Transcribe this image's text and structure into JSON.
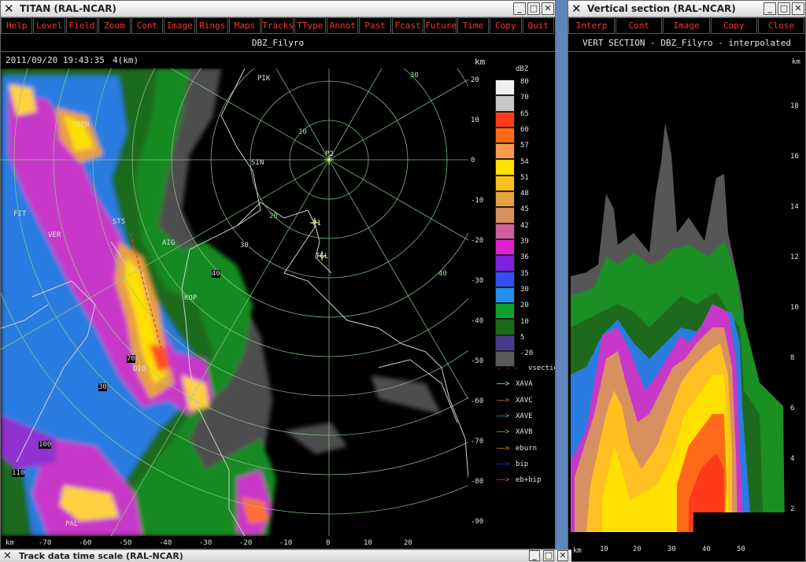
{
  "main_window": {
    "title": "TITAN (RAL-NCAR)",
    "menu": [
      "Help",
      "Level",
      "Field",
      "Zoom",
      "Cont",
      "Image",
      "Rings",
      "Maps",
      "Tracks",
      "TType",
      "Annot",
      "Past",
      "Fcast",
      "Future",
      "Time",
      "Copy",
      "Quit"
    ],
    "field_title": "DBZ_Filyro",
    "datetime": "2011/09/20 19:43:35",
    "height": "4(km)",
    "km_label": "km",
    "y_ticks": [
      "20",
      "10",
      "0",
      "-10",
      "-20",
      "-30",
      "-40",
      "-50",
      "-60",
      "-70",
      "-80",
      "-90"
    ],
    "x_ticks": [
      "-70",
      "-60",
      "-50",
      "-40",
      "-30",
      "-20",
      "-10",
      "0",
      "10",
      "20"
    ],
    "legend_title": "dBZ",
    "legend": [
      {
        "v": "80",
        "c": "#f0f0f0"
      },
      {
        "v": "70",
        "c": "#c8c8c8"
      },
      {
        "v": "65",
        "c": "#ff3a1a"
      },
      {
        "v": "60",
        "c": "#ff6a1a"
      },
      {
        "v": "57",
        "c": "#ff9a50"
      },
      {
        "v": "54",
        "c": "#ffe000"
      },
      {
        "v": "51",
        "c": "#ffc020"
      },
      {
        "v": "48",
        "c": "#e6a040"
      },
      {
        "v": "45",
        "c": "#d89060"
      },
      {
        "v": "42",
        "c": "#d060a0"
      },
      {
        "v": "39",
        "c": "#e020d0"
      },
      {
        "v": "36",
        "c": "#8020e0"
      },
      {
        "v": "35",
        "c": "#3050f0"
      },
      {
        "v": "30",
        "c": "#2090e8"
      },
      {
        "v": "20",
        "c": "#10a030"
      },
      {
        "v": "10",
        "c": "#1a6a1a"
      },
      {
        "v": "5",
        "c": "#4a3a8a"
      },
      {
        "v": "-20",
        "c": "#5a5a5a"
      }
    ],
    "arrow_legend": [
      {
        "label": "vsection",
        "c": "#ff3030"
      },
      {
        "label": "XAVA",
        "c": "#ffffff"
      },
      {
        "label": "XAVC",
        "c": "#ff8040"
      },
      {
        "label": "XAVE",
        "c": "#40c0ff"
      },
      {
        "label": "XAVB",
        "c": "#40ff40"
      },
      {
        "label": "eburn",
        "c": "#ffa030"
      },
      {
        "label": "bip",
        "c": "#2040ff"
      },
      {
        "label": "eb+bip",
        "c": "#e040e0"
      }
    ],
    "map_labels": [
      "PIK",
      "SIN",
      "STN",
      "FIT",
      "VER",
      "STS",
      "AIG",
      "KOP",
      "DIO",
      "PAL",
      "P2",
      "P1",
      "TGL"
    ],
    "ring_labels": [
      "10",
      "20",
      "30",
      "40"
    ],
    "cell_labels": [
      "30",
      "40",
      "70",
      "30",
      "100",
      "110"
    ]
  },
  "vert_window": {
    "title": "Vertical section (RAL-NCAR)",
    "menu": [
      "Interp",
      "Cont",
      "Image",
      "Copy",
      "Close"
    ],
    "field_title": "VERT SECTION - DBZ_Filyro - interpolated",
    "km_label": "km",
    "y_ticks": [
      "18",
      "16",
      "14",
      "12",
      "10",
      "8",
      "6",
      "4",
      "2"
    ],
    "x_ticks": [
      "10",
      "20",
      "30",
      "40",
      "50"
    ]
  },
  "taskbar": {
    "title": "Track data time scale (RAL-NCAR)"
  }
}
